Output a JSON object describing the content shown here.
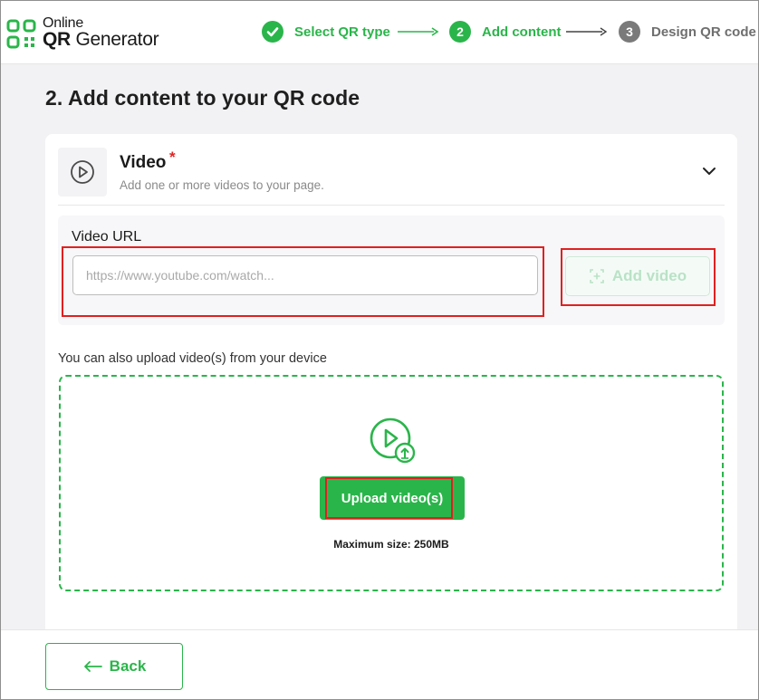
{
  "brand": {
    "line1": "Online",
    "line2_qr": "QR",
    "line2_rest": " Generator",
    "accent_color": "#2ab54a"
  },
  "stepper": {
    "steps": [
      {
        "number": "✓",
        "label": "Select QR type",
        "state": "done"
      },
      {
        "number": "2",
        "label": "Add content",
        "state": "active"
      },
      {
        "number": "3",
        "label": "Design QR code",
        "state": "upcoming"
      }
    ]
  },
  "page": {
    "title": "2. Add content to your QR code"
  },
  "video_section": {
    "icon": "play-circle-icon",
    "title": "Video",
    "required_mark": "*",
    "subtitle": "Add one or more videos to your page.",
    "url_label": "Video URL",
    "url_placeholder": "https://www.youtube.com/watch...",
    "url_value": "",
    "add_button": "Add video",
    "upload_note": "You can also upload video(s) from your device",
    "upload_button": "Upload video(s)",
    "max_size": "Maximum size: 250MB"
  },
  "footer": {
    "back_button": "Back"
  }
}
